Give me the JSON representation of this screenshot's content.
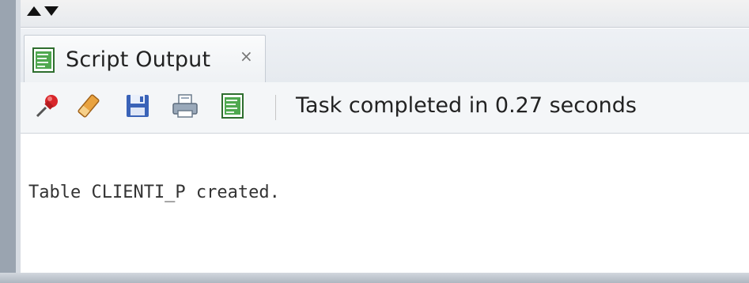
{
  "panel": {
    "tab_label": "Script Output",
    "tab_close": "×",
    "status_text": "Task completed in 0.27 seconds"
  },
  "toolbar": {
    "icons": [
      "pin-icon",
      "eraser-icon",
      "save-icon",
      "print-icon",
      "script-output-icon"
    ]
  },
  "output": {
    "text": "Table CLIENTI_P created."
  }
}
